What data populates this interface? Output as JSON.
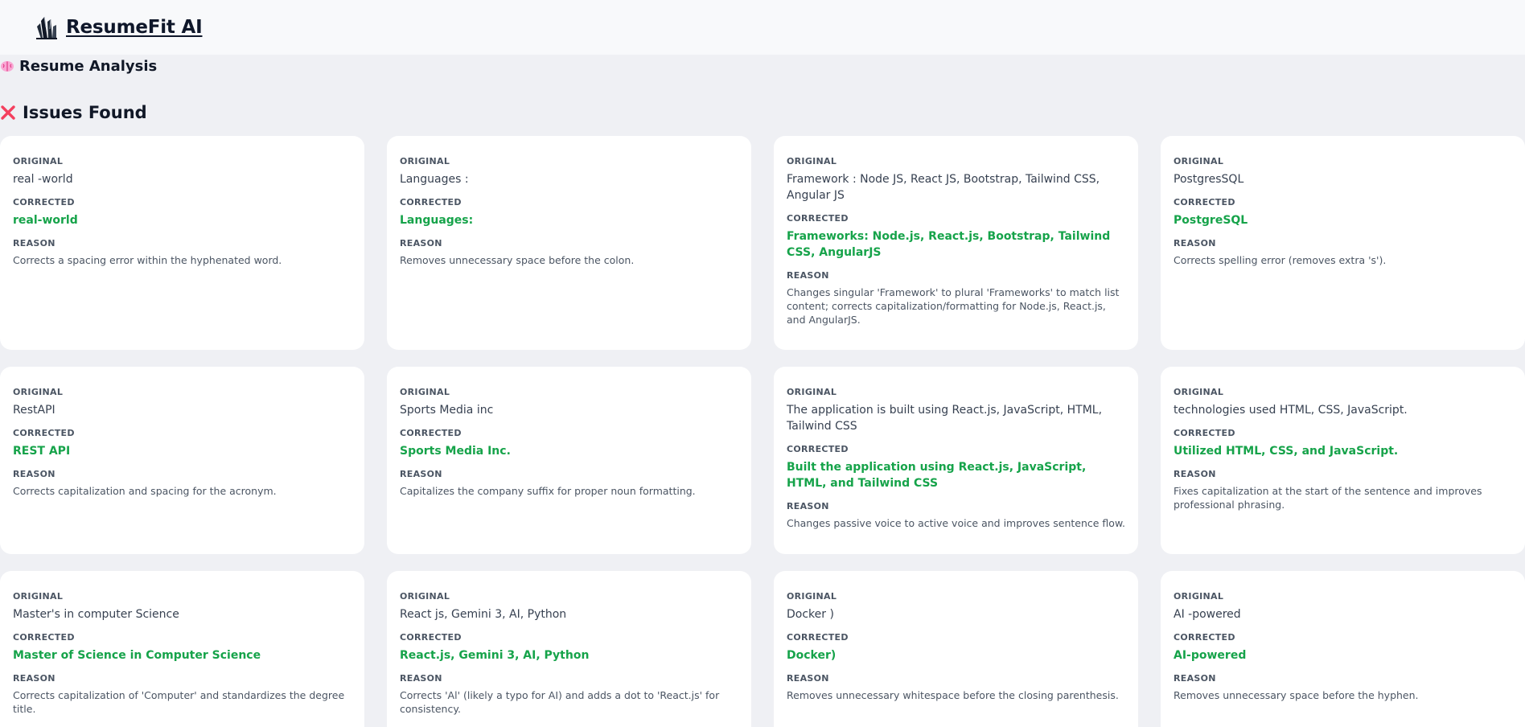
{
  "app": {
    "name": "ResumeFit AI"
  },
  "page": {
    "section_title": "Resume Analysis",
    "issues_title": "Issues Found",
    "labels": {
      "original": "ORIGINAL",
      "corrected": "CORRECTED",
      "reason": "REASON"
    }
  },
  "colors": {
    "corrected_text": "#16a34a",
    "issues_icon": "#e11d48",
    "brain_icon": "#f472b6"
  },
  "icons": {
    "brand": "crystal-cluster-icon",
    "section": "brain-icon",
    "issues": "cross-mark-icon"
  },
  "issues": [
    {
      "original": "real -world",
      "corrected": "real-world",
      "reason": "Corrects a spacing error within the hyphenated word."
    },
    {
      "original": "Languages :",
      "corrected": "Languages:",
      "reason": "Removes unnecessary space before the colon."
    },
    {
      "original": "Framework : Node JS, React JS, Bootstrap, Tailwind CSS, Angular JS",
      "corrected": "Frameworks: Node.js, React.js, Bootstrap, Tailwind CSS, AngularJS",
      "reason": "Changes singular 'Framework' to plural 'Frameworks' to match list content; corrects capitalization/formatting for Node.js, React.js, and AngularJS."
    },
    {
      "original": "PostgresSQL",
      "corrected": "PostgreSQL",
      "reason": "Corrects spelling error (removes extra 's')."
    },
    {
      "original": "RestAPI",
      "corrected": "REST API",
      "reason": "Corrects capitalization and spacing for the acronym."
    },
    {
      "original": "Sports Media inc",
      "corrected": "Sports Media Inc.",
      "reason": "Capitalizes the company suffix for proper noun formatting."
    },
    {
      "original": "The application is built using React.js, JavaScript, HTML, Tailwind CSS",
      "corrected": "Built the application using React.js, JavaScript, HTML, and Tailwind CSS",
      "reason": "Changes passive voice to active voice and improves sentence flow."
    },
    {
      "original": "technologies used HTML, CSS, JavaScript.",
      "corrected": "Utilized HTML, CSS, and JavaScript.",
      "reason": "Fixes capitalization at the start of the sentence and improves professional phrasing."
    },
    {
      "original": "Master's in computer Science",
      "corrected": "Master of Science in Computer Science",
      "reason": "Corrects capitalization of 'Computer' and standardizes the degree title."
    },
    {
      "original": "React js, Gemini 3, AI, Python",
      "corrected": "React.js, Gemini 3, AI, Python",
      "reason": "Corrects 'Al' (likely a typo for AI) and adds a dot to 'React.js' for consistency."
    },
    {
      "original": "Docker )",
      "corrected": "Docker)",
      "reason": "Removes unnecessary whitespace before the closing parenthesis."
    },
    {
      "original": "AI -powered",
      "corrected": "AI-powered",
      "reason": "Removes unnecessary space before the hyphen."
    }
  ]
}
